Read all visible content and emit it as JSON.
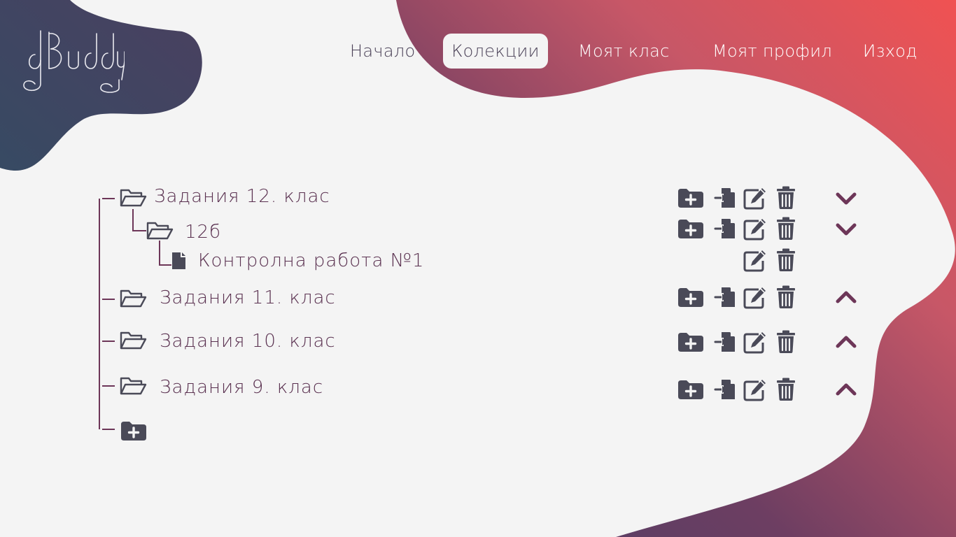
{
  "app": {
    "logo_text": "dBuddy"
  },
  "nav": {
    "items": [
      {
        "label": "Начало"
      },
      {
        "label": "Колекции"
      },
      {
        "label": "Моят клас"
      },
      {
        "label": "Моят профил"
      },
      {
        "label": "Изход"
      }
    ],
    "active_index": 1
  },
  "tree": {
    "rows": [
      {
        "label": "Задания 12. клас",
        "type": "folder",
        "level": 0,
        "expanded": true
      },
      {
        "label": "12б",
        "type": "folder",
        "level": 1,
        "expanded": true
      },
      {
        "label": "Контролна работа №1",
        "type": "file",
        "level": 2
      },
      {
        "label": "Задания 11. клас",
        "type": "folder",
        "level": 0,
        "expanded": false
      },
      {
        "label": "Задания 10. клас",
        "type": "folder",
        "level": 0,
        "expanded": false
      },
      {
        "label": "Задания 9. клас",
        "type": "folder",
        "level": 0,
        "expanded": false
      }
    ]
  },
  "icons": {
    "folder_open": "folder-open-icon",
    "file": "file-icon",
    "add_folder": "folder-plus-icon",
    "import": "file-import-icon",
    "edit": "edit-icon",
    "delete": "trash-icon",
    "collapse": "chevron-down-icon",
    "expand": "chevron-up-icon"
  },
  "colors": {
    "background": "#f4f4f4",
    "icon_dark": "#4a4a58",
    "accent": "#6d3658",
    "gradient_dark": "#4a3f66",
    "gradient_red": "#f05252",
    "logo_blob": "#3c4a65"
  }
}
